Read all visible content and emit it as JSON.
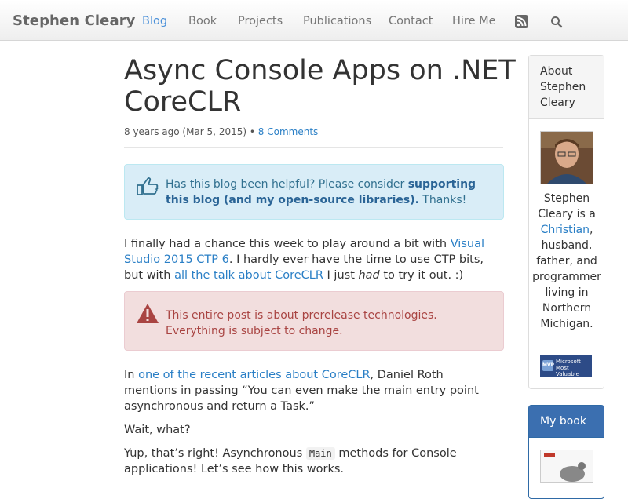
{
  "nav": {
    "brand": "Stephen Cleary",
    "items": [
      {
        "label": "Blog",
        "active": true
      },
      {
        "label": "Book"
      },
      {
        "label": "Projects"
      },
      {
        "label": "Publications"
      },
      {
        "label": "Contact"
      },
      {
        "label": "Hire Me"
      }
    ],
    "rss_icon": "rss-icon",
    "search_icon": "search-icon"
  },
  "post": {
    "title": "Async Console Apps on .NET CoreCLR",
    "meta": {
      "date": "8 years ago (Mar 5, 2015)",
      "separator": "•",
      "comments": "8 Comments"
    },
    "info_alert": {
      "icon": "thumbs-up-icon",
      "text_before": "Has this blog been helpful? Please consider ",
      "link": "supporting this blog (and my open-source libraries).",
      "text_after": " Thanks!"
    },
    "para1": {
      "t1": "I finally had a chance this week to play around a bit with ",
      "link1": "Visual Studio 2015 CTP 6",
      "t2": ". I hardly ever have the time to use CTP bits, but with ",
      "link2": "all the talk about CoreCLR",
      "t3": " I just ",
      "em": "had",
      "t4": " to try it out. :)"
    },
    "danger_alert": {
      "icon": "warning-icon",
      "text": "This entire post is about prerelease technologies. Everything is subject to change."
    },
    "para2": {
      "t1": "In ",
      "link": "one of the recent articles about CoreCLR",
      "t2": ", Daniel Roth mentions in passing “You can even make the main entry point asynchronous and return a Task.”"
    },
    "para3": "Wait, what?",
    "para4": {
      "t1": "Yup, that’s right! Asynchronous ",
      "code": "Main",
      "t2": " methods for Console applications! Let’s see how this works."
    }
  },
  "sidebar": {
    "about": {
      "heading": "About Stephen Cleary",
      "text1": "Stephen Cleary is a ",
      "link": "Christian",
      "text2": ", husband, father, and programmer living in Northern Michigan.",
      "badge": "Microsoft Most Valuable Professional",
      "badge_logo": "MVP"
    },
    "book": {
      "heading": "My book"
    }
  },
  "colors": {
    "link": "#2a7fc6",
    "info_bg": "#d9edf7",
    "danger_bg": "#f2dede",
    "book_head": "#3b6fb0"
  }
}
